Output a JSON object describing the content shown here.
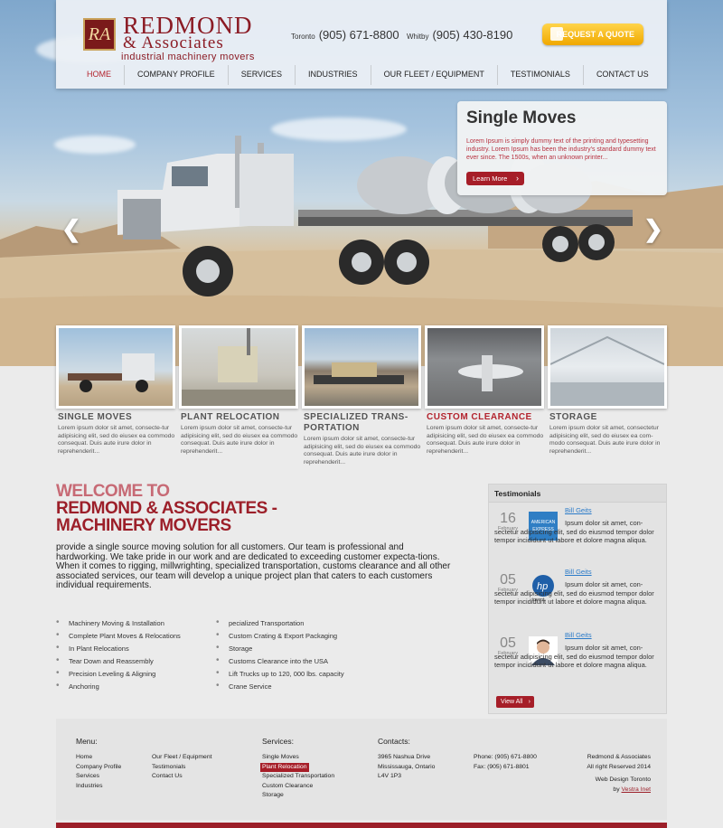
{
  "header": {
    "logo_mark": "RA",
    "logo_name": "REDMOND",
    "logo_sub": "& Associates",
    "logo_tagline": "industrial machinery movers",
    "phones": [
      {
        "city": "Toronto",
        "number": "(905) 671-8800"
      },
      {
        "city": "Whitby",
        "number": "(905) 430-8190"
      }
    ],
    "quote_button": "REQUEST A QUOTE"
  },
  "nav": [
    "HOME",
    "COMPANY PROFILE",
    "SERVICES",
    "INDUSTRIES",
    "OUR FLEET / EQUIPMENT",
    "TESTIMONIALS",
    "CONTACT US"
  ],
  "slider": {
    "title": "Single Moves",
    "text": "Lorem Ipsum is simply dummy text of the printing and typesetting industry. Lorem Ipsum has been the industry's standard dummy text ever since. The 1500s, when an unknown printer...",
    "button": "Learn More",
    "prev": "❮",
    "next": "❯"
  },
  "services": [
    {
      "title": "SINGLE MOVES",
      "text": "Lorem ipsum dolor sit amet, consecte-tur adipisicing elit, sed do eiusex ea commodo consequat. Duis aute irure dolor in reprehenderit..."
    },
    {
      "title": "PLANT RELOCATION",
      "text": "Lorem ipsum dolor sit amet, consecte-tur adipisicing elit, sed do eiusex ea commodo consequat. Duis aute irure dolor in reprehenderit..."
    },
    {
      "title": "SPECIALIZED TRANS-PORTATION",
      "text": "Lorem ipsum dolor sit amet, consecte-tur adipisicing elit, sed do eiusex ea commodo consequat. Duis aute irure dolor in reprehenderit..."
    },
    {
      "title": "CUSTOM CLEARANCE",
      "text": "Lorem ipsum dolor sit amet, consecte-tur adipisicing elit, sed do eiusex ea commodo consequat. Duis aute irure dolor in reprehenderit..."
    },
    {
      "title": "STORAGE",
      "text": "Lorem ipsum dolor sit amet, consectetur adipisicing elit, sed do eiusex ea com-modo consequat. Duis aute irure dolor in reprehenderit..."
    }
  ],
  "welcome": {
    "line1": "WELCOME TO",
    "line2": "REDMOND & ASSOCIATES -",
    "line3": "MACHINERY MOVERS",
    "p1": "provide a single source moving solution for all customers.  Our team is professional and hardworking.  We take pride in our work and are dedicated to exceeding customer expecta-tions.",
    "p2": "When it comes to rigging, millwrighting, specialized transportation, customs clearance and all other associated services, our team will develop a unique project plan that caters to each customers individual requirements.",
    "list_left": [
      "Machinery Moving & Installation",
      "Complete Plant Moves & Relocations",
      "In Plant Relocations",
      "Tear Down and Reassembly",
      "Precision Leveling & Aligning",
      "Anchoring"
    ],
    "list_right": [
      "pecialized Transportation",
      "Custom Crating & Export Packaging",
      "Storage",
      "Customs Clearance into the USA",
      "Lift Trucks up to 120, 000 lbs. capacity",
      "Crane Service"
    ]
  },
  "testimonials": {
    "heading": "Testimonials",
    "items": [
      {
        "day": "16",
        "month": "February",
        "name": "Bill Geits",
        "logo": "american-express",
        "text": "Ipsum dolor sit amet, con-sectetur adipisicing elit, sed do eiusmod tempor dolor tempor incididunt ut labore et dolore magna aliqua."
      },
      {
        "day": "05",
        "month": "February",
        "name": "Bill Geits",
        "logo": "hp",
        "text": "Ipsum dolor sit amet, con-sectetur adipisicing elit, sed do eiusmod tempor dolor tempor incididunt ut labore et dolore magna aliqua."
      },
      {
        "day": "05",
        "month": "February",
        "name": "Bill Geits",
        "logo": "person-photo",
        "text": "Ipsum dolor sit amet, con-sectetur adipisicing elit, sed do eiusmod tempor dolor tempor incididunt ut labore et dolore magna aliqua."
      }
    ],
    "view_all": "View All"
  },
  "footer": {
    "menu_heading": "Menu:",
    "menu_col1": [
      "Home",
      "Company Profile",
      "Services",
      "Industries"
    ],
    "menu_col2": [
      "Our Fleet / Equipment",
      "Testimonials",
      "Contact Us"
    ],
    "services_heading": "Services:",
    "services": [
      "Single Moves",
      "Plant Relocation",
      "Specialized Transportation",
      "Custom Clearance",
      "Storage"
    ],
    "contacts_heading": "Contacts:",
    "address": [
      "3965 Nashua Drive",
      "Mississauga, Ontario",
      "L4V 1P3"
    ],
    "phone": "Phone: (905) 671-8800",
    "fax": "Fax: (905) 671-8801",
    "copyright1": "Redmond & Associates",
    "copyright2": "All right Reserved 2014",
    "design": "Web Design Toronto",
    "by": "by",
    "designer": "Vestra Inet"
  }
}
